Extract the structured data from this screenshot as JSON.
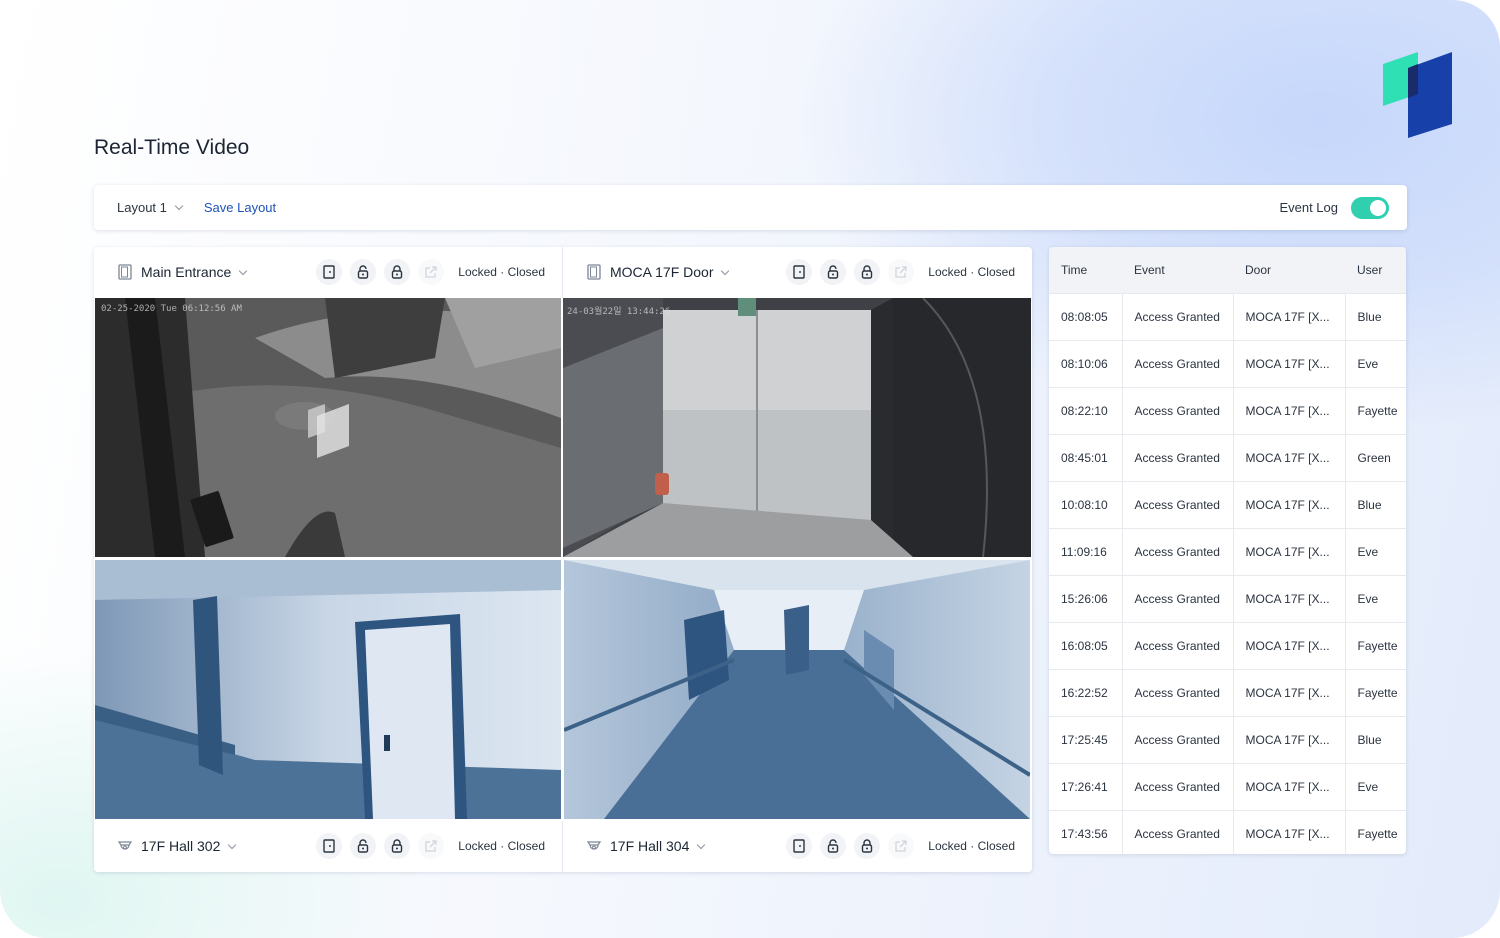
{
  "page": {
    "title": "Real-Time Video"
  },
  "toolbar": {
    "layout_select": "Layout 1",
    "save_layout": "Save Layout",
    "event_log_label": "Event Log",
    "event_log_enabled": true
  },
  "cameras": [
    {
      "name": "Main Entrance",
      "status": "Locked · Closed",
      "type": "door",
      "overlay": "02-25-2020 Tue 06:12:56 AM"
    },
    {
      "name": "MOCA 17F Door",
      "status": "Locked · Closed",
      "type": "door",
      "overlay": "24-03월22일 13:44:26"
    },
    {
      "name": "17F Hall 302",
      "status": "Locked · Closed",
      "type": "camera"
    },
    {
      "name": "17F Hall 304",
      "status": "Locked · Closed",
      "type": "camera"
    }
  ],
  "camera_controls": [
    "door-icon",
    "unlock-icon",
    "lock-icon",
    "external-link-icon"
  ],
  "colors": {
    "accent": "#2fcfb0",
    "link": "#1f53b8",
    "logo_teal": "#2ee0b4",
    "logo_blue": "#1740a8"
  },
  "event_log": {
    "columns": [
      "Time",
      "Event",
      "Door",
      "User"
    ],
    "rows": [
      [
        "08:08:05",
        "Access Granted",
        "MOCA 17F [X...",
        "Blue"
      ],
      [
        "08:10:06",
        "Access Granted",
        "MOCA 17F [X...",
        "Eve"
      ],
      [
        "08:22:10",
        "Access Granted",
        "MOCA 17F [X...",
        "Fayette"
      ],
      [
        "08:45:01",
        "Access Granted",
        "MOCA 17F [X...",
        "Green"
      ],
      [
        "10:08:10",
        "Access Granted",
        "MOCA 17F [X...",
        "Blue"
      ],
      [
        "11:09:16",
        "Access Granted",
        "MOCA 17F [X...",
        "Eve"
      ],
      [
        "15:26:06",
        "Access Granted",
        "MOCA 17F [X...",
        "Eve"
      ],
      [
        "16:08:05",
        "Access Granted",
        "MOCA 17F [X...",
        "Fayette"
      ],
      [
        "16:22:52",
        "Access Granted",
        "MOCA 17F [X...",
        "Fayette"
      ],
      [
        "17:25:45",
        "Access Granted",
        "MOCA 17F [X...",
        "Blue"
      ],
      [
        "17:26:41",
        "Access Granted",
        "MOCA 17F [X...",
        "Eve"
      ],
      [
        "17:43:56",
        "Access Granted",
        "MOCA 17F [X...",
        "Fayette"
      ]
    ]
  }
}
